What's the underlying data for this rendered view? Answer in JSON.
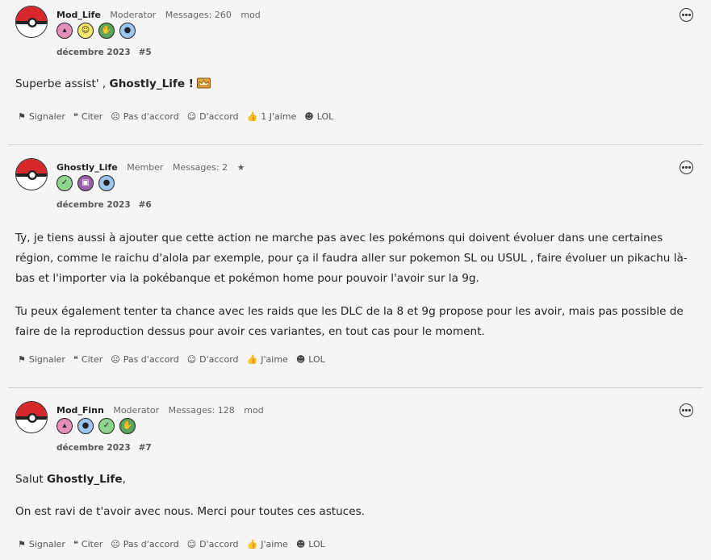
{
  "posts": [
    {
      "username": "Mod_Life",
      "role": "Moderator",
      "messages": "Messages: 260",
      "extra": "mod",
      "badges": [
        {
          "icon": "cake-icon",
          "color": "#e48fb8",
          "glyph": "🎂"
        },
        {
          "icon": "smiley-icon",
          "color": "#f6e66a",
          "glyph": "☺"
        },
        {
          "icon": "thumbs-up-icon",
          "color": "#5aa55c",
          "glyph": "👍"
        },
        {
          "icon": "speech-bubble-icon",
          "color": "#9cc6ee",
          "glyph": "💬"
        }
      ],
      "date": "décembre 2023",
      "post_number": "#5",
      "paragraphs": [
        {
          "before": "Superbe assist' , ",
          "bold": "Ghostly_Life !",
          "after": "",
          "emoji": "crown-icon"
        }
      ],
      "actions": [
        "Signaler",
        "Citer",
        "Pas d'accord",
        "D'accord",
        "1 J'aime",
        "LOL"
      ]
    },
    {
      "username": "Ghostly_Life",
      "role": "Member",
      "messages": "Messages: 2",
      "extra": "★",
      "badges": [
        {
          "icon": "checkmark-icon",
          "color": "#8fd48f",
          "glyph": "✓"
        },
        {
          "icon": "phone-icon",
          "color": "#9a5fa8",
          "glyph": "▣"
        },
        {
          "icon": "speech-bubble-icon",
          "color": "#9cc6ee",
          "glyph": "💬"
        }
      ],
      "date": "décembre 2023",
      "post_number": "#6",
      "paragraphs": [
        {
          "before": "Ty, je tiens aussi à ajouter que cette action ne marche pas avec les pokémons qui doivent évoluer dans une certaines région, comme le raichu d'alola par exemple, pour ça il faudra aller sur pokemon SL ou USUL , faire évoluer un pikachu là-bas et l'importer via la pokébanque et pokémon home pour pouvoir l'avoir sur la 9g.",
          "bold": "",
          "after": ""
        },
        {
          "before": "Tu peux également tenter ta chance avec les raids que les DLC de la 8 et 9g propose pour les avoir, mais pas possible de faire de la reproduction dessus pour avoir ces variantes, en tout cas pour le moment.",
          "bold": "",
          "after": ""
        }
      ],
      "actions": [
        "Signaler",
        "Citer",
        "Pas d'accord",
        "D'accord",
        "J'aime",
        "LOL"
      ]
    },
    {
      "username": "Mod_Finn",
      "role": "Moderator",
      "messages": "Messages: 128",
      "extra": "mod",
      "badges": [
        {
          "icon": "cake-icon",
          "color": "#e48fb8",
          "glyph": "🎂"
        },
        {
          "icon": "speech-bubble-icon",
          "color": "#9cc6ee",
          "glyph": "💬"
        },
        {
          "icon": "checkmark-icon",
          "color": "#8fd48f",
          "glyph": "✓"
        },
        {
          "icon": "thumbs-up-icon",
          "color": "#5aa55c",
          "glyph": "👍"
        }
      ],
      "date": "décembre 2023",
      "post_number": "#7",
      "paragraphs": [
        {
          "before": "Salut ",
          "bold": "Ghostly_Life",
          "after": ","
        },
        {
          "before": "On est ravi de t'avoir avec nous. Merci pour toutes ces astuces.",
          "bold": "",
          "after": ""
        }
      ],
      "actions": [
        "Signaler",
        "Citer",
        "Pas d'accord",
        "D'accord",
        "J'aime",
        "LOL"
      ]
    }
  ],
  "action_icons": [
    "flag-icon",
    "quote-icon",
    "frown-icon",
    "smile-icon",
    "thumbs-up-icon",
    "laugh-icon"
  ]
}
